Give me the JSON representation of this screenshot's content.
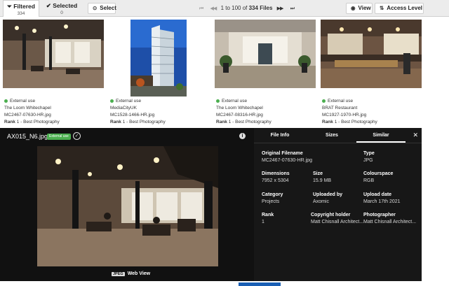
{
  "toolbar": {
    "tabs": [
      {
        "label": "Filtered",
        "count": "334"
      },
      {
        "label": "Selected",
        "count": "0"
      }
    ],
    "select_label": "Select",
    "pager": {
      "range": "1 to 100 of",
      "total": "334",
      "unit": "Files"
    },
    "view_label": "View",
    "access_label": "Access Level"
  },
  "cards": [
    {
      "usage": "External use",
      "project": "The Loom Whitechapel",
      "file": "MC2467-07630-HR.jpg",
      "rank_label": "Rank",
      "rank_value": "1 - Best Photography"
    },
    {
      "usage": "External use",
      "project": "MediaCityUK",
      "file": "MC1528-1466-HR.jpg",
      "rank_label": "Rank",
      "rank_value": "1 - Best Photography"
    },
    {
      "usage": "External use",
      "project": "The Loom Whitechapel",
      "file": "MC2467-08316-HR.jpg",
      "rank_label": "Rank",
      "rank_value": "1 - Best Photography"
    },
    {
      "usage": "External use",
      "project": "BRAT Restaurant",
      "file": "MC1927-1970-HR.jpg",
      "rank_label": "Rank",
      "rank_value": "1 - Best Photography"
    }
  ],
  "detail": {
    "filename": "AX015_N6.jpg",
    "badge": "External use",
    "webview_type": "JPEG",
    "webview_label": "Web View",
    "tabs": [
      "File Info",
      "Sizes",
      "Similar"
    ],
    "active_tab": "Similar",
    "fields": {
      "original_filename": {
        "label": "Original Filename",
        "value": "MC2467-07630-HR.jpg"
      },
      "type": {
        "label": "Type",
        "value": "JPG"
      },
      "dimensions": {
        "label": "Dimensions",
        "value": "7952 x 5304"
      },
      "size": {
        "label": "Size",
        "value": "15.9 MB"
      },
      "colourspace": {
        "label": "Colourspace",
        "value": "RGB"
      },
      "category": {
        "label": "Category",
        "value": "Projects"
      },
      "uploaded_by": {
        "label": "Uploaded by",
        "value": "Axomic"
      },
      "upload_date": {
        "label": "Upload date",
        "value": "March 17th 2021"
      },
      "rank": {
        "label": "Rank",
        "value": "1"
      },
      "copyright_holder": {
        "label": "Copyright holder",
        "value": "Matt Chisnall Architect..."
      },
      "photographer": {
        "label": "Photographer",
        "value": "Matt Chisnall Architect..."
      }
    }
  },
  "colors": {
    "accent_green": "#4caf50",
    "overlay_bg": "#111111",
    "toolbar_bg": "#ececec"
  },
  "icons": [
    "filter-icon",
    "check-icon",
    "first-page-icon",
    "prev-page-icon",
    "next-page-icon",
    "last-page-icon",
    "eye-icon",
    "access-icon",
    "info-icon",
    "close-icon"
  ]
}
